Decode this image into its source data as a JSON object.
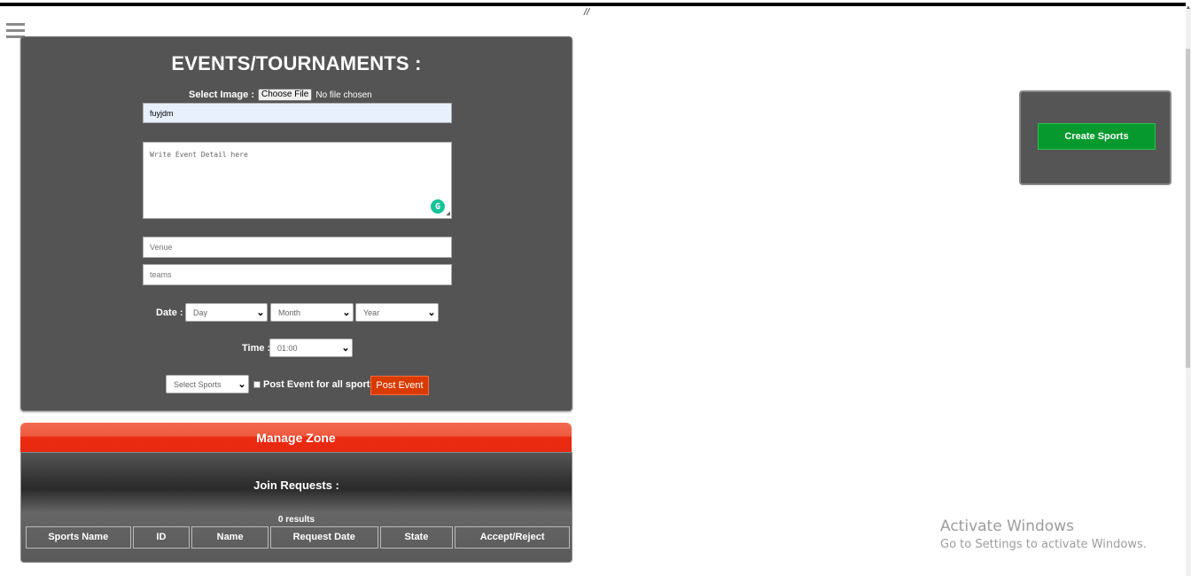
{
  "header": {
    "slashes": "//"
  },
  "events": {
    "title": "EVENTS/TOURNAMENTS :",
    "image_label": "Select Image :",
    "choose_file": "Choose File",
    "no_file": "No file chosen",
    "event_name_value": "fuyjdm",
    "detail_placeholder": "Write Event Detail here",
    "venue_placeholder": "Venue",
    "teams_placeholder": "teams",
    "date_label": "Date :",
    "day": "Day",
    "month": "Month",
    "year": "Year",
    "time_label": "Time :",
    "time_value": "01:00",
    "sports_select": "Select Sports",
    "all_sports_label": "Post Event for all sports",
    "post_button": "Post Event"
  },
  "manage": {
    "title": "Manage Zone",
    "join_title": "Join Requests :",
    "results": "0 results",
    "columns": [
      "Sports Name",
      "ID",
      "Name",
      "Request Date",
      "State",
      "Accept/Reject"
    ]
  },
  "sidebar_right": {
    "create_button": "Create Sports"
  },
  "watermark": {
    "title": "Activate Windows",
    "subtitle": "Go to Settings to activate Windows."
  },
  "colors": {
    "panel": "#545454",
    "post_button": "#d93a00",
    "create_button": "#069a2e",
    "manage_bar": "#e8280f"
  }
}
